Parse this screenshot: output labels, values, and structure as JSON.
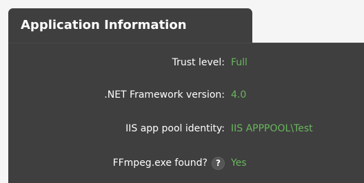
{
  "panel": {
    "title": "Application Information"
  },
  "rows": [
    {
      "label": "Trust level:",
      "value": "Full"
    },
    {
      "label": ".NET Framework version:",
      "value": "4.0"
    },
    {
      "label": "IIS app pool identity:",
      "value": "IIS APPPOOL\\Test"
    },
    {
      "label": "FFmpeg.exe found?",
      "help_glyph": "?",
      "value": "Yes"
    }
  ],
  "colors": {
    "panel_background": "#3f3f3f",
    "label_text": "#ffffff",
    "value_text": "#69b75d"
  },
  "icons": {
    "help": "help-icon"
  }
}
